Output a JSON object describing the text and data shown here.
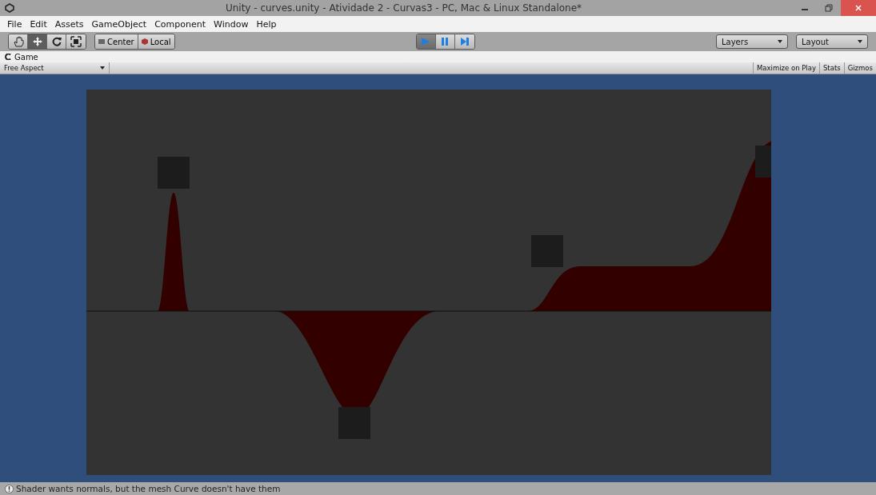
{
  "window": {
    "title": "Unity - curves.unity - Atividade 2 - Curvas3 - PC, Mac & Linux Standalone*"
  },
  "menu": [
    "File",
    "Edit",
    "Assets",
    "GameObject",
    "Component",
    "Window",
    "Help"
  ],
  "toolbar": {
    "tools": [
      {
        "kind": "hand",
        "selected": false
      },
      {
        "kind": "move",
        "selected": true
      },
      {
        "kind": "rotate",
        "selected": false
      },
      {
        "kind": "scale",
        "selected": false
      }
    ],
    "pivot": [
      "Center",
      "Local"
    ],
    "playback": [
      {
        "kind": "play",
        "selected": true
      },
      {
        "kind": "pause",
        "selected": false
      },
      {
        "kind": "step",
        "selected": false
      }
    ],
    "layers": "Layers",
    "layout": "Layout"
  },
  "game_tab": {
    "label": "Game"
  },
  "game_toolbar": {
    "aspect": "Free Aspect",
    "buttons": [
      "Maximize on Play",
      "Stats",
      "Gizmos"
    ]
  },
  "status_bar": {
    "message": "Shader wants normals, but the mesh Curve doesn't have them"
  }
}
